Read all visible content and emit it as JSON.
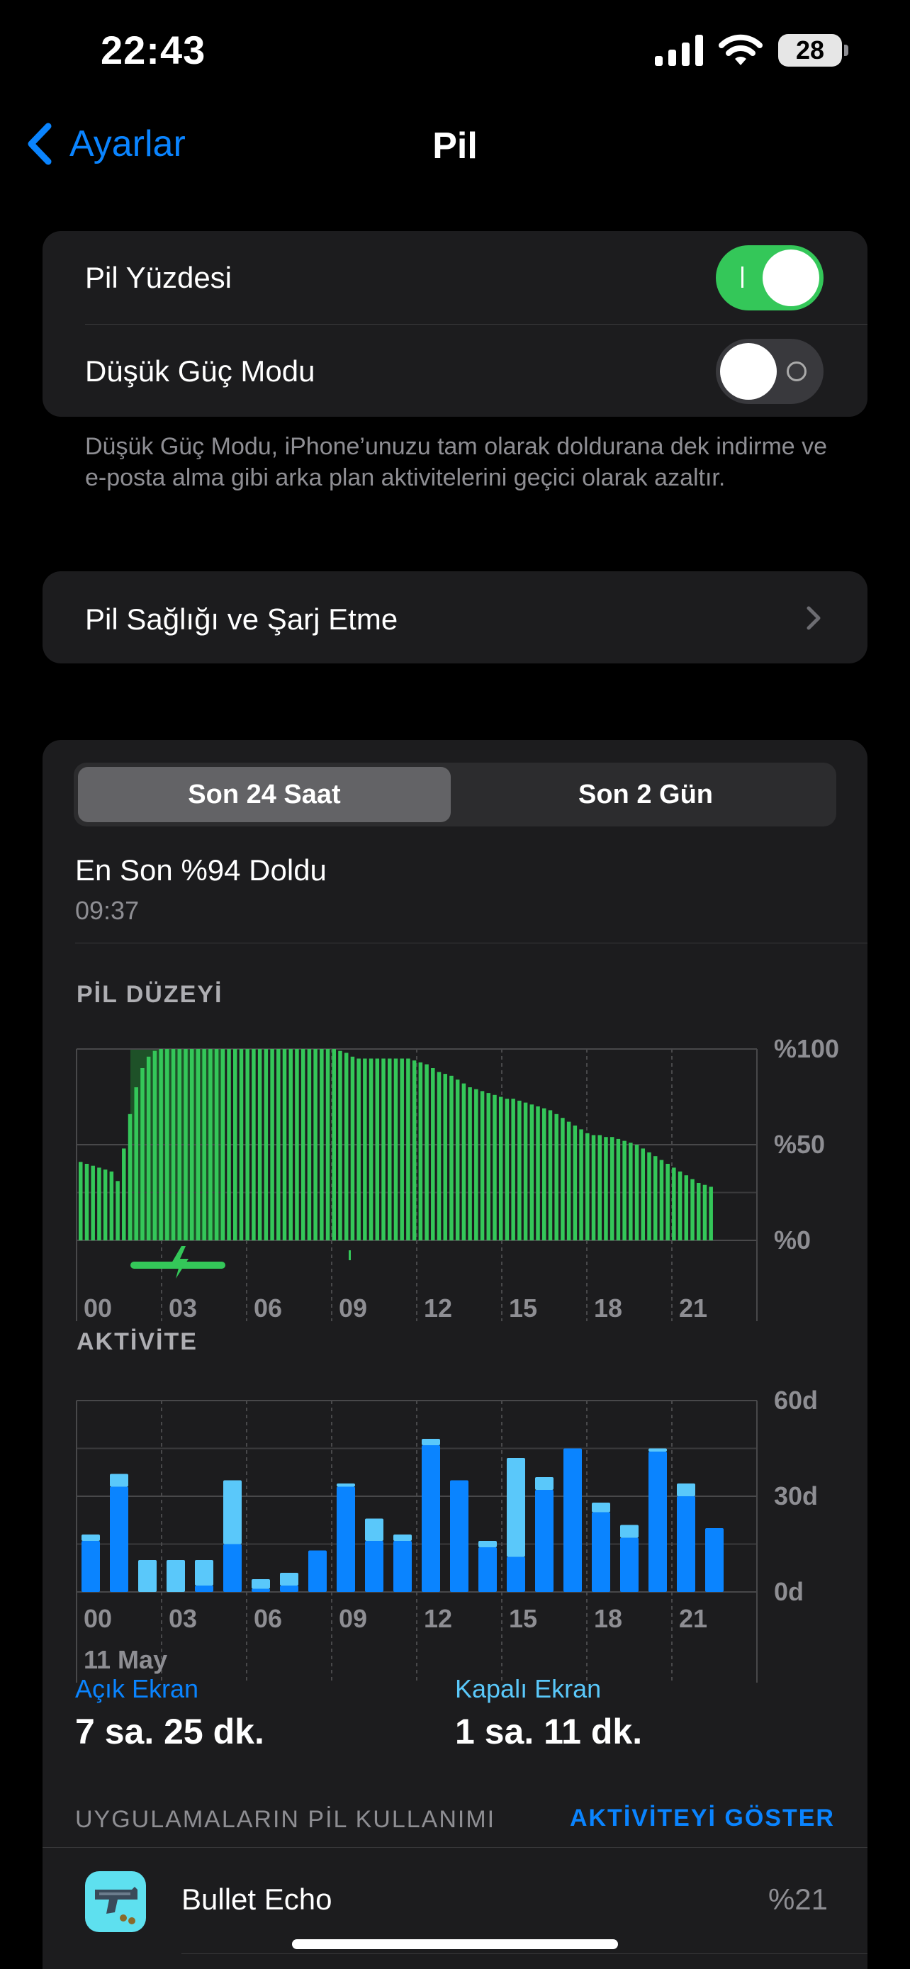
{
  "status": {
    "time": "22:43",
    "battery": "28",
    "battery_level": 28
  },
  "nav": {
    "back_label": "Ayarlar",
    "title": "Pil"
  },
  "settings": {
    "battery_percentage_label": "Pil Yüzdesi",
    "battery_percentage_on": true,
    "low_power_label": "Düşük Güç Modu",
    "low_power_on": false,
    "footnote": "Düşük Güç Modu, iPhone’unuzu tam olarak doldurana dek indirme ve e-posta alma gibi arka plan aktivitelerini geçici olarak azaltır.",
    "health_label": "Pil Sağlığı ve Şarj Etme"
  },
  "usage": {
    "tabs": [
      "Son 24 Saat",
      "Son 2 Gün"
    ],
    "active_tab": 0,
    "last_charged_label": "En Son %94 Doldu",
    "last_charged_time": "09:37",
    "battery_level_title": "PİL DÜZEYİ",
    "activity_title": "AKTİVİTE",
    "date_label": "11 May",
    "screen_on_label": "Açık Ekran",
    "screen_on_value": "7 sa. 25 dk.",
    "screen_off_label": "Kapalı Ekran",
    "screen_off_value": "1 sa. 11 dk.",
    "apps_header": "UYGULAMALARIN PİL KULLANIMI",
    "show_activity": "AKTİVİTEYİ GÖSTER",
    "apps": [
      {
        "name": "Bullet Echo",
        "percent": "%21"
      }
    ]
  },
  "colors": {
    "accent": "#0a84ff",
    "green": "#34c759",
    "screen_on": "#0a84ff",
    "screen_off": "#5ac8fa"
  },
  "chart_data": [
    {
      "type": "bar",
      "title": "PİL DÜZEYİ",
      "x_tick_labels": [
        "00",
        "03",
        "06",
        "09",
        "12",
        "15",
        "18",
        "21"
      ],
      "y_tick_labels": [
        "%100",
        "%50",
        "%0"
      ],
      "ylim": [
        0,
        100
      ],
      "series": [
        {
          "values": [
            41,
            40,
            39,
            38,
            37,
            36,
            31,
            48,
            66,
            80,
            90,
            96,
            99,
            100,
            100,
            100,
            100,
            100,
            100,
            100,
            100,
            100,
            100,
            100,
            100,
            100,
            100,
            100,
            100,
            100,
            100,
            100,
            100,
            100,
            100,
            100,
            100,
            100,
            100,
            100,
            100,
            100,
            99,
            98,
            96,
            95,
            95,
            95,
            95,
            95,
            95,
            95,
            95,
            95,
            94,
            93,
            92,
            90,
            88,
            87,
            86,
            84,
            82,
            80,
            79,
            78,
            77,
            76,
            75,
            74,
            74,
            73,
            72,
            71,
            70,
            69,
            68,
            66,
            64,
            62,
            60,
            58,
            56,
            55,
            55,
            54,
            54,
            53,
            52,
            51,
            50,
            48,
            46,
            44,
            42,
            40,
            38,
            36,
            34,
            32,
            30,
            29,
            28
          ]
        }
      ],
      "charging_range": [
        1.9,
        5.25
      ],
      "grid": true
    },
    {
      "type": "bar",
      "title": "AKTİVİTE",
      "categories": [
        "00",
        "01",
        "02",
        "03",
        "04",
        "05",
        "06",
        "07",
        "08",
        "09",
        "10",
        "11",
        "12",
        "13",
        "14",
        "15",
        "16",
        "17",
        "18",
        "19",
        "20",
        "21",
        "22"
      ],
      "x_tick_labels": [
        "00",
        "03",
        "06",
        "09",
        "12",
        "15",
        "18",
        "21"
      ],
      "y_tick_labels": [
        "60d",
        "30d",
        "0d"
      ],
      "ylim": [
        0,
        60
      ],
      "series": [
        {
          "name": "Açık Ekran",
          "values": [
            16,
            33,
            0,
            0,
            2,
            15,
            1,
            2,
            13,
            33,
            16,
            16,
            46,
            35,
            14,
            11,
            32,
            45,
            25,
            17,
            44,
            30,
            20
          ]
        },
        {
          "name": "Kapalı Ekran",
          "values": [
            2,
            4,
            10,
            10,
            8,
            20,
            3,
            4,
            0,
            1,
            7,
            2,
            2,
            0,
            2,
            31,
            4,
            0,
            3,
            4,
            1,
            4,
            0
          ]
        }
      ],
      "grid": true
    }
  ]
}
